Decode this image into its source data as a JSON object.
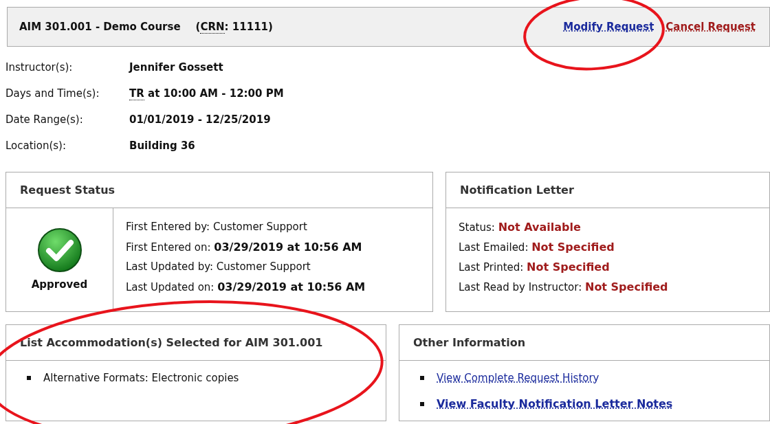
{
  "header": {
    "title": "AIM 301.001 - Demo Course",
    "crn": {
      "prefix": "(",
      "abbr": "CRN",
      "suffix": ": 11111)"
    },
    "actions": [
      {
        "label": "Modify Request",
        "kind": "primary"
      },
      {
        "label": "Cancel Request",
        "kind": "danger"
      }
    ]
  },
  "details": [
    {
      "label": "Instructor(s):",
      "value": "Jennifer Gossett"
    },
    {
      "label": "Days and Time(s):",
      "abbr": "TR",
      "value": " at 10:00 AM - 12:00 PM"
    },
    {
      "label": "Date Range(s):",
      "value": "01/01/2019 - 12/25/2019"
    },
    {
      "label": "Location(s):",
      "value": "Building 36"
    }
  ],
  "request_status": {
    "title": "Request Status",
    "status": "Approved",
    "lines": [
      {
        "label": "First Entered by:",
        "value": "Customer Support",
        "bold": false
      },
      {
        "label": "First Entered on:",
        "value": "03/29/2019 at 10:56 AM",
        "bold": true
      },
      {
        "label": "Last Updated by:",
        "value": "Customer Support",
        "bold": false
      },
      {
        "label": "Last Updated on:",
        "value": "03/29/2019 at 10:56 AM",
        "bold": true
      }
    ]
  },
  "notification_letter": {
    "title": "Notification Letter",
    "lines": [
      {
        "label": "Status:",
        "value": "Not Available"
      },
      {
        "label": "Last Emailed:",
        "value": "Not Specified"
      },
      {
        "label": "Last Printed:",
        "value": "Not Specified"
      },
      {
        "label": "Last Read by Instructor:",
        "value": "Not Specified"
      }
    ]
  },
  "accommodations": {
    "title": "List Accommodation(s) Selected for AIM 301.001",
    "items": [
      "Alternative Formats: Electronic copies"
    ]
  },
  "other_information": {
    "title": "Other Information",
    "links": [
      {
        "label": "View Complete Request History",
        "bold": false
      },
      {
        "label": "View Faculty Notification Letter Notes",
        "bold": true
      }
    ]
  },
  "annotations": [
    {
      "kind": "ellipse"
    },
    {
      "kind": "ellipse"
    }
  ]
}
